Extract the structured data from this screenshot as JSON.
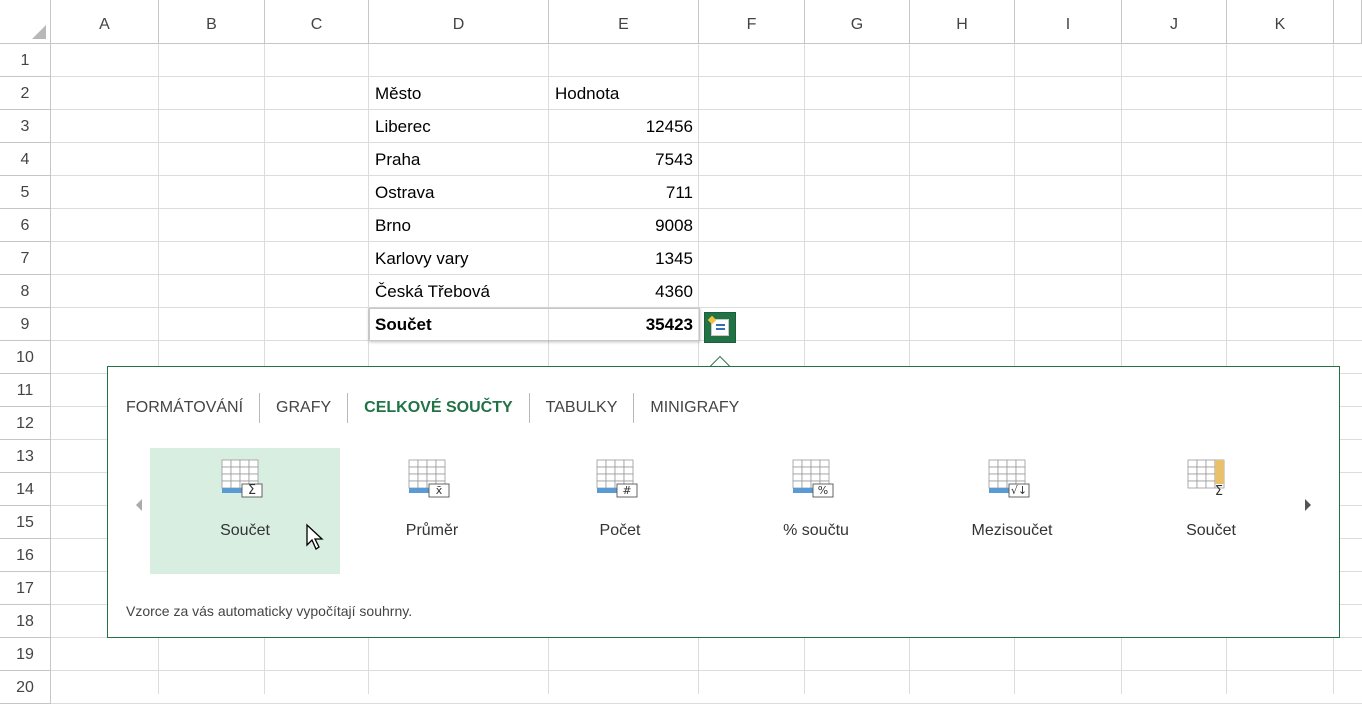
{
  "columns": [
    "A",
    "B",
    "C",
    "D",
    "E",
    "F",
    "G",
    "H",
    "I",
    "J",
    "K"
  ],
  "rows": [
    "1",
    "2",
    "3",
    "4",
    "5",
    "6",
    "7",
    "8",
    "9",
    "10",
    "11",
    "12",
    "13",
    "14",
    "15",
    "16",
    "17",
    "18",
    "19",
    "20"
  ],
  "table": {
    "header_city": "Město",
    "header_value": "Hodnota",
    "rows": [
      {
        "city": "Liberec",
        "value": "12456"
      },
      {
        "city": "Praha",
        "value": "7543"
      },
      {
        "city": "Ostrava",
        "value": "711"
      },
      {
        "city": "Brno",
        "value": "9008"
      },
      {
        "city": "Karlovy vary",
        "value": "1345"
      },
      {
        "city": "Česká Třebová",
        "value": "4360"
      }
    ],
    "total_label": "Součet",
    "total_value": "35423"
  },
  "quick_analysis": {
    "button_icon": "quick-analysis-icon",
    "tabs": [
      {
        "label": "FORMÁTOVÁNÍ",
        "active": false
      },
      {
        "label": "GRAFY",
        "active": false
      },
      {
        "label": "CELKOVÉ SOUČTY",
        "active": true
      },
      {
        "label": "TABULKY",
        "active": false
      },
      {
        "label": "MINIGRAFY",
        "active": false
      }
    ],
    "options": [
      {
        "label": "Součet",
        "icon": "sum-row-icon",
        "symbol": "Σ",
        "active": true
      },
      {
        "label": "Průměr",
        "icon": "average-row-icon",
        "symbol": "x̄",
        "active": false
      },
      {
        "label": "Počet",
        "icon": "count-row-icon",
        "symbol": "#",
        "active": false
      },
      {
        "label": "% součtu",
        "icon": "percent-total-icon",
        "symbol": "%",
        "active": false
      },
      {
        "label": "Mezisoučet",
        "icon": "running-total-icon",
        "symbol": "√↓",
        "active": false
      },
      {
        "label": "Součet",
        "icon": "sum-column-icon",
        "symbol": "Σ",
        "active": false
      }
    ],
    "description": "Vzorce za vás automaticky vypočítají souhrny.",
    "accent_color": "#217346",
    "active_bg": "#d7eee1"
  }
}
